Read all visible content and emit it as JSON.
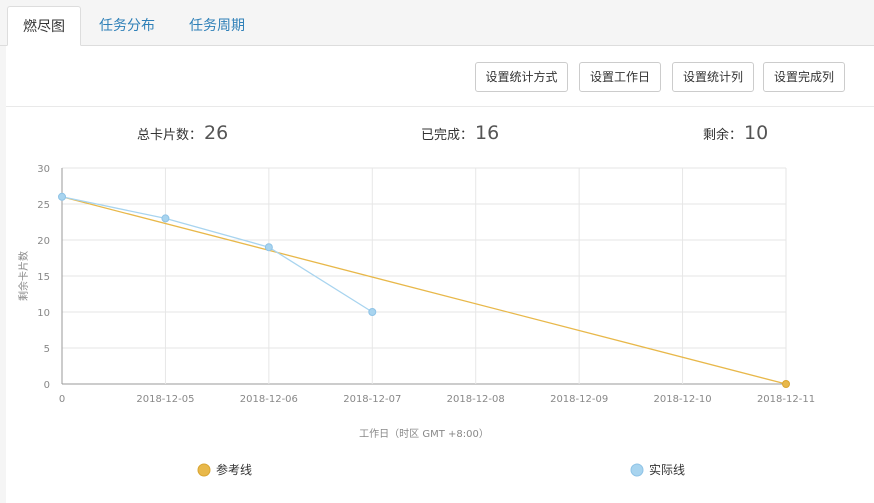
{
  "tabs": [
    {
      "label": "燃尽图",
      "active": true
    },
    {
      "label": "任务分布",
      "active": false
    },
    {
      "label": "任务周期",
      "active": false
    }
  ],
  "toolbar": {
    "buttons": [
      "设置统计方式",
      "设置工作日",
      "设置统计列",
      "设置完成列"
    ]
  },
  "stats": {
    "total_label": "总卡片数：",
    "total_value": "26",
    "done_label": "已完成：",
    "done_value": "16",
    "remaining_label": "剩余：",
    "remaining_value": "10"
  },
  "colors": {
    "reference": "#e8b84a",
    "actual": "#a8d4ef",
    "grid": "#e6e6e6",
    "axis": "#999999",
    "tab_link": "#2f80b8"
  },
  "chart_data": {
    "type": "line",
    "categories": [
      "0",
      "2018-12-05",
      "2018-12-06",
      "2018-12-07",
      "2018-12-08",
      "2018-12-09",
      "2018-12-10",
      "2018-12-11"
    ],
    "series": [
      {
        "name": "参考线",
        "points": [
          [
            0,
            26
          ],
          [
            7,
            0
          ]
        ]
      },
      {
        "name": "实际线",
        "points": [
          [
            0,
            26
          ],
          [
            1,
            23
          ],
          [
            2,
            19
          ],
          [
            3,
            10
          ]
        ]
      }
    ],
    "ylim": [
      0,
      30
    ],
    "yticks": [
      0,
      5,
      10,
      15,
      20,
      25,
      30
    ],
    "xlabel": "工作日（时区 GMT +8:00）",
    "ylabel": "剩余卡片数",
    "grid": true,
    "legend_position": "bottom"
  }
}
